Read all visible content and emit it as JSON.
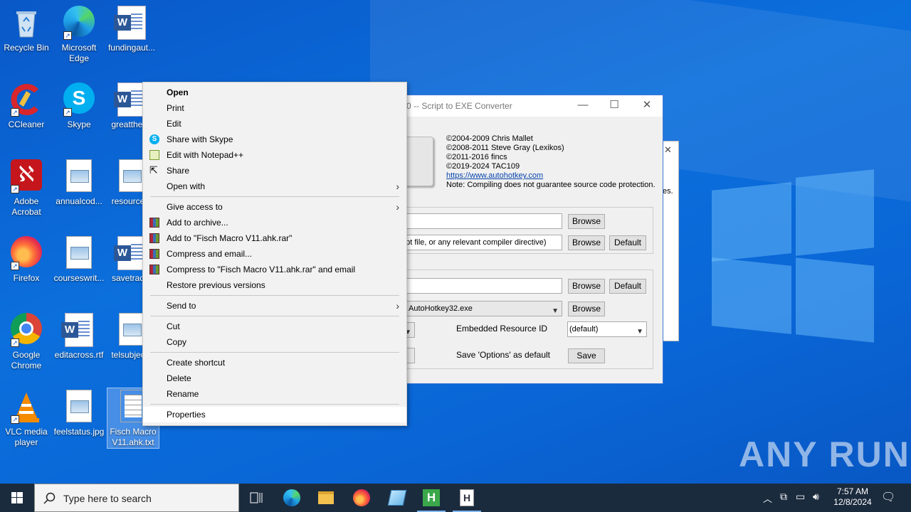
{
  "desktop": {
    "icons": [
      {
        "label": "Recycle Bin",
        "icon": "recycle-bin-icon"
      },
      {
        "label": "Microsoft Edge",
        "icon": "edge-icon"
      },
      {
        "label": "fundingaut...",
        "icon": "word-doc-icon"
      },
      {
        "label": "CCleaner",
        "icon": "ccleaner-icon"
      },
      {
        "label": "Skype",
        "icon": "skype-icon"
      },
      {
        "label": "greatther...",
        "icon": "word-doc-icon"
      },
      {
        "label": "Adobe Acrobat",
        "icon": "acrobat-icon"
      },
      {
        "label": "annualcod...",
        "icon": "image-file-icon"
      },
      {
        "label": "resource...",
        "icon": "image-file-icon"
      },
      {
        "label": "Firefox",
        "icon": "firefox-icon"
      },
      {
        "label": "courseswrit...",
        "icon": "image-file-icon"
      },
      {
        "label": "savetrad...",
        "icon": "word-doc-icon"
      },
      {
        "label": "Google Chrome",
        "icon": "chrome-icon"
      },
      {
        "label": "editacross.rtf",
        "icon": "word-doc-icon"
      },
      {
        "label": "telsubjec...",
        "icon": "image-file-icon"
      },
      {
        "label": "VLC media player",
        "icon": "vlc-icon"
      },
      {
        "label": "feelstatus.jpg",
        "icon": "image-file-icon"
      },
      {
        "label": "Fisch Macro V11.ahk.txt",
        "icon": "text-file-icon"
      }
    ]
  },
  "ahk_window": {
    "title": "0 -- Script to EXE Converter",
    "credits": [
      "©2004-2009 Chris Mallet",
      "©2008-2011 Steve Gray (Lexikos)",
      "©2011-2016 fincs",
      "©2019-2024 TAC109"
    ],
    "link": "https://www.autohotkey.com",
    "note": "Note: Compiling does not guarantee source code protection.",
    "dest_hint": "ript file, or any relevant compiler directive)",
    "base_file": "AutoHotkey32.exe",
    "embedded_resource_label": "Embedded Resource ID",
    "embedded_resource_value": "(default)",
    "save_options_label": "Save 'Options' as default",
    "browse": "Browse",
    "default": "Default",
    "save": "Save",
    "minimize": "—",
    "maximize": "☐",
    "close": "✕",
    "side_dialog_text": "es."
  },
  "context_menu": {
    "items": [
      {
        "label": "Open",
        "bold": true
      },
      {
        "label": "Print"
      },
      {
        "label": "Edit"
      },
      {
        "label": "Share with Skype",
        "icon": "skype-icon"
      },
      {
        "label": "Edit with Notepad++",
        "icon": "notepad-plus-icon"
      },
      {
        "label": "Share",
        "icon": "share-icon"
      },
      {
        "label": "Open with",
        "submenu": true
      },
      {
        "label": "Give access to",
        "submenu": true
      },
      {
        "label": "Add to archive...",
        "icon": "winrar-icon"
      },
      {
        "label": "Add to \"Fisch Macro V11.ahk.rar\"",
        "icon": "winrar-icon"
      },
      {
        "label": "Compress and email...",
        "icon": "winrar-icon"
      },
      {
        "label": "Compress to \"Fisch Macro V11.ahk.rar\" and email",
        "icon": "winrar-icon"
      },
      {
        "label": "Restore previous versions"
      },
      {
        "label": "Send to",
        "submenu": true
      },
      {
        "label": "Cut"
      },
      {
        "label": "Copy"
      },
      {
        "label": "Create shortcut"
      },
      {
        "label": "Delete"
      },
      {
        "label": "Rename"
      },
      {
        "label": "Properties"
      }
    ]
  },
  "taskbar": {
    "search_placeholder": "Type here to search",
    "time": "7:57 AM",
    "date": "12/8/2024",
    "apps": [
      "task-view-icon",
      "edge-icon",
      "file-explorer-icon",
      "firefox-icon",
      "notepad-icon",
      "hiew-icon",
      "ahk-compiler-icon"
    ]
  },
  "watermark": "ANY RUN",
  "colors": {
    "desktop": "#0a66d6",
    "taskbar": "#1b2b3e",
    "menu": "#f2f2f2"
  }
}
